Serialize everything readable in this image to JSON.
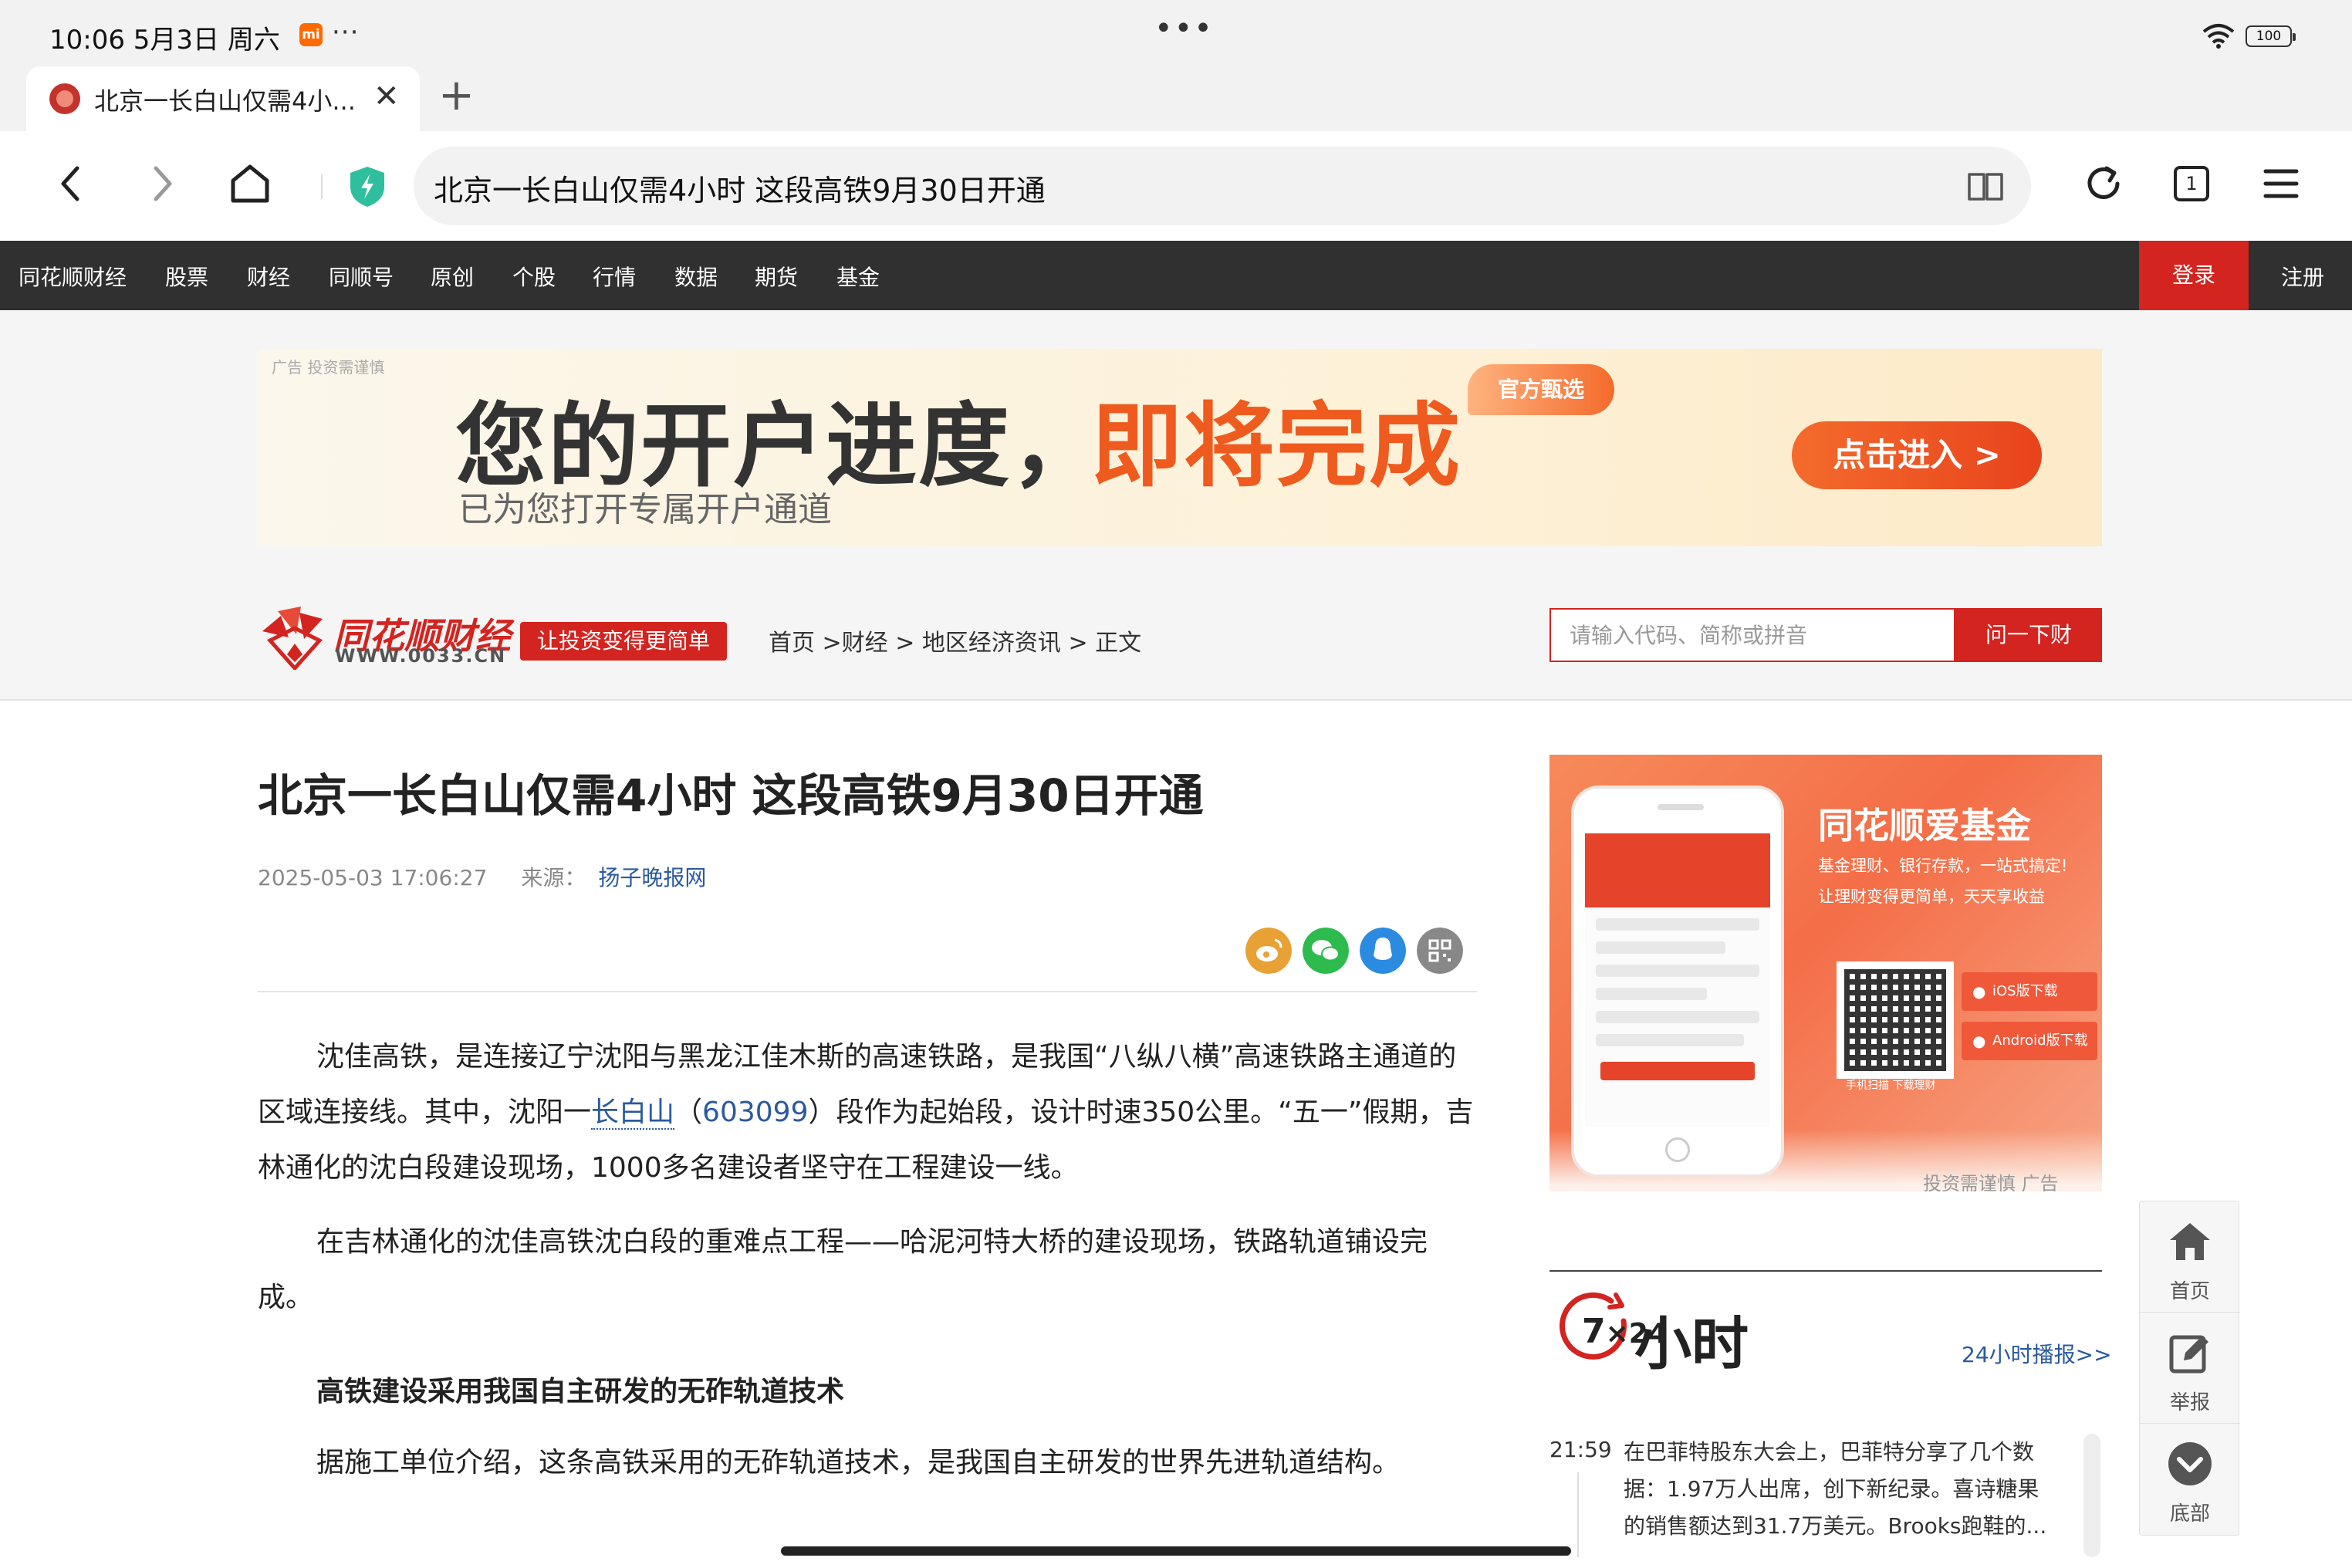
{
  "status_bar": {
    "time": "10:06  5月3日 周六",
    "mi_label": "mi",
    "more": "···",
    "battery": "100"
  },
  "browser": {
    "tab_title": "北京一长白山仅需4小...",
    "address": "北京一长白山仅需4小时 这段高铁9月30日开通",
    "tab_count": "1",
    "new_tab": "+",
    "close_tab": "✕"
  },
  "site_nav": {
    "items": [
      "同花顺财经",
      "股票",
      "财经",
      "同顺号",
      "原创",
      "个股",
      "行情",
      "数据",
      "期货",
      "基金"
    ],
    "login": "登录",
    "register": "注册"
  },
  "ad_banner": {
    "tag": "广告 投资需谨慎",
    "headline": "您的开户进度，",
    "headline_accent": "即将完成",
    "badge": "官方甄选",
    "subline": "已为您打开专属开户通道",
    "cta": "点击进入 >"
  },
  "site_header": {
    "logo_text": "同花顺财经",
    "logo_url": "WWW.0033.CN",
    "slogan": "让投资变得更简单",
    "breadcrumb": [
      "首页 >",
      "财经 >",
      "地区经济资讯 >",
      "正文"
    ],
    "search_placeholder": "请输入代码、简称或拼音",
    "search_button": "问一下财"
  },
  "article": {
    "title": "北京一长白山仅需4小时 这段高铁9月30日开通",
    "datetime": "2025-05-03 17:06:27",
    "source_label": "来源：",
    "source": "扬子晚报网",
    "p1_a": "沈佳高铁，是连接辽宁沈阳与黑龙江佳木斯的高速铁路，是我国“八纵八横”高速铁路主通道的区域连接线。其中，沈阳一",
    "p1_link": "长白山",
    "p1_b": "（",
    "p1_code": "603099",
    "p1_c": "）段作为起始段，设计时速350公里。“五一”假期，吉林通化的沈白段建设现场，1000多名建设者坚守在工程建设一线。",
    "p2": "在吉林通化的沈佳高铁沈白段的重难点工程——哈泥河特大桥的建设现场，铁路轨道铺设完成。",
    "subhead": "高铁建设采用我国自主研发的无砟轨道技术",
    "p3": "据施工单位介绍，这条高铁采用的无砟轨道技术，是我国自主研发的世界先进轨道结构。"
  },
  "side_ad": {
    "brand": "同花顺爱基金",
    "line1": "基金理财、银行存款，一站式搞定!",
    "line2": "让理财变得更简单，天天享收益",
    "qr_caption": "手机扫描 下载理财",
    "ios": "iOS版下载",
    "android": "Android版下载",
    "note": "投资需谨慎  广告"
  },
  "news_24h": {
    "badge_number": "7",
    "badge_small": "×24",
    "title": "小时",
    "more": "24小时播报>>",
    "time": "21:59",
    "text": "在巴菲特股东大会上，巴菲特分享了几个数据：1.97万人出席，创下新纪录。喜诗糖果的销售额达到31.7万美元。Brooks跑鞋的..."
  },
  "float_tools": {
    "home": "首页",
    "report": "举报",
    "bottom": "底部"
  },
  "colors": {
    "brand_red": "#d32420",
    "nav_dark": "#303030",
    "link_blue": "#2a5a9e",
    "ad_orange": "#ef5b1e"
  }
}
